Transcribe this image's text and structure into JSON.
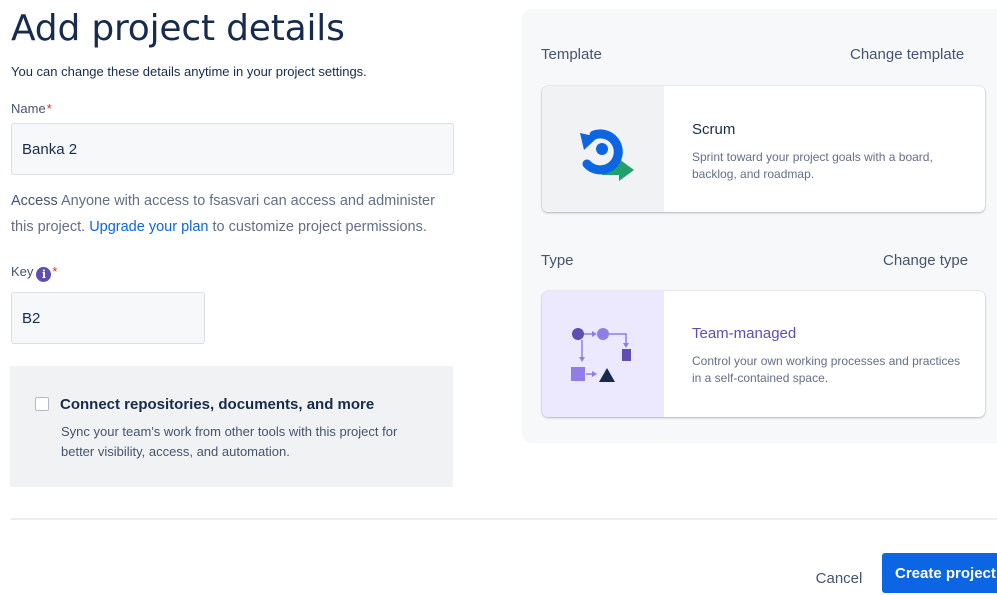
{
  "header": {
    "title": "Add project details",
    "subtitle": "You can change these details anytime in your project settings."
  },
  "form": {
    "name": {
      "label": "Name",
      "required_mark": "*",
      "value": "Banka 2"
    },
    "access": {
      "label": "Access",
      "text": "Anyone with access to fsasvari can access and administer this project.",
      "link": "Upgrade your plan",
      "text_after": "to customize project permissions."
    },
    "key": {
      "label": "Key",
      "info_glyph": "i",
      "required_mark": "*",
      "value": "B2"
    },
    "connect": {
      "title": "Connect repositories, documents, and more",
      "description": "Sync your team's work from other tools with this project for better visibility, access, and automation.",
      "checked": false
    }
  },
  "template_section": {
    "label": "Template",
    "change_label": "Change template",
    "card": {
      "title": "Scrum",
      "description": "Sprint toward your project goals with a board, backlog, and roadmap.",
      "icon": "scrum-icon"
    }
  },
  "type_section": {
    "label": "Type",
    "change_label": "Change type",
    "card": {
      "title": "Team-managed",
      "description": "Control your own working processes and practices in a self-contained space.",
      "icon": "team-managed-icon"
    }
  },
  "footer": {
    "cancel_label": "Cancel",
    "create_label": "Create project"
  },
  "colors": {
    "primary": "#0c66e4",
    "required": "#c9372c",
    "team_managed_title": "#5e4db2",
    "info_icon": "#5e4db2"
  }
}
